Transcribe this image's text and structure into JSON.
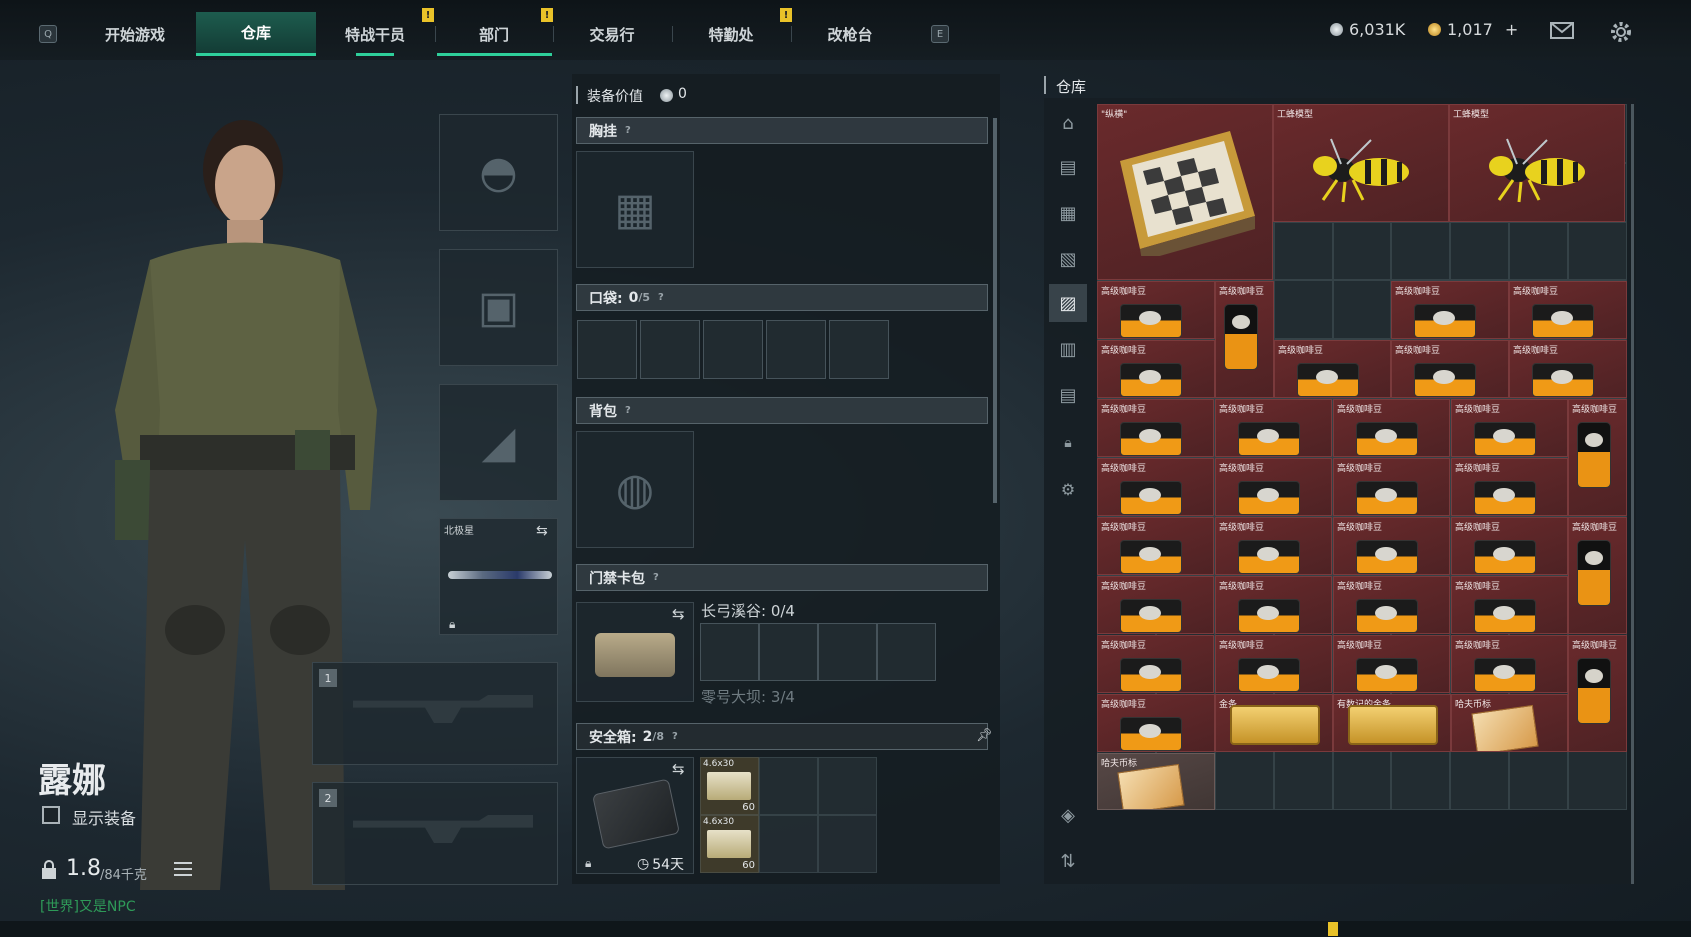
{
  "topbar": {
    "left_key": "Q",
    "right_key": "E",
    "tabs": [
      {
        "label": "开始游戏",
        "active": false,
        "badge": ""
      },
      {
        "label": "仓库",
        "active": true,
        "badge": ""
      },
      {
        "label": "特战干员",
        "active": false,
        "badge": "!"
      },
      {
        "label": "部门",
        "active": false,
        "badge": "!"
      },
      {
        "label": "交易行",
        "active": false,
        "badge": ""
      },
      {
        "label": "特勤处",
        "active": false,
        "badge": "!"
      },
      {
        "label": "改枪台",
        "active": false,
        "badge": ""
      }
    ],
    "currency_silver": "6,031K",
    "currency_gold": "1,017",
    "gold_plus": "+"
  },
  "character": {
    "name": "露娜",
    "show_equipment_label": "显示装备",
    "weight_value": "1.8",
    "weight_max": "/84千克",
    "chat_prefix": "[世界]",
    "chat_text": "又是NPC"
  },
  "left_slots": {
    "melee_name": "北极星",
    "weapon1_index": "1",
    "weapon2_index": "2"
  },
  "equipment": {
    "value_label": "装备价值",
    "value": "0",
    "chest_label": "胸挂",
    "pocket_label": "口袋:",
    "pocket_count": "0",
    "pocket_max": "/5",
    "backpack_label": "背包",
    "keycard_label": "门禁卡包",
    "keycard_line1": "长弓溪谷: 0/4",
    "keycard_line2": "零号大坝: 3/4",
    "safebox_label": "安全箱:",
    "safebox_count": "2",
    "safebox_max": "/8",
    "safebox_days": "54天",
    "ammo": [
      {
        "name": "4.6x30",
        "count": "60"
      },
      {
        "name": "4.6x30",
        "count": "60"
      }
    ],
    "help": "?"
  },
  "warehouse": {
    "title": "仓库",
    "items": {
      "chess": "\"纵横\"",
      "wasp1": "工蜂模型",
      "wasp2": "工蜂模型",
      "coffee": "高级咖啡豆",
      "gold1": "金条",
      "gold2": "有数记的金条",
      "hafu1": "哈夫币标",
      "hafu2": "哈夫币标"
    }
  },
  "colors": {
    "accent": "#2ecf9a",
    "item_red": "#5e2527",
    "badge_yellow": "#e9c229"
  }
}
